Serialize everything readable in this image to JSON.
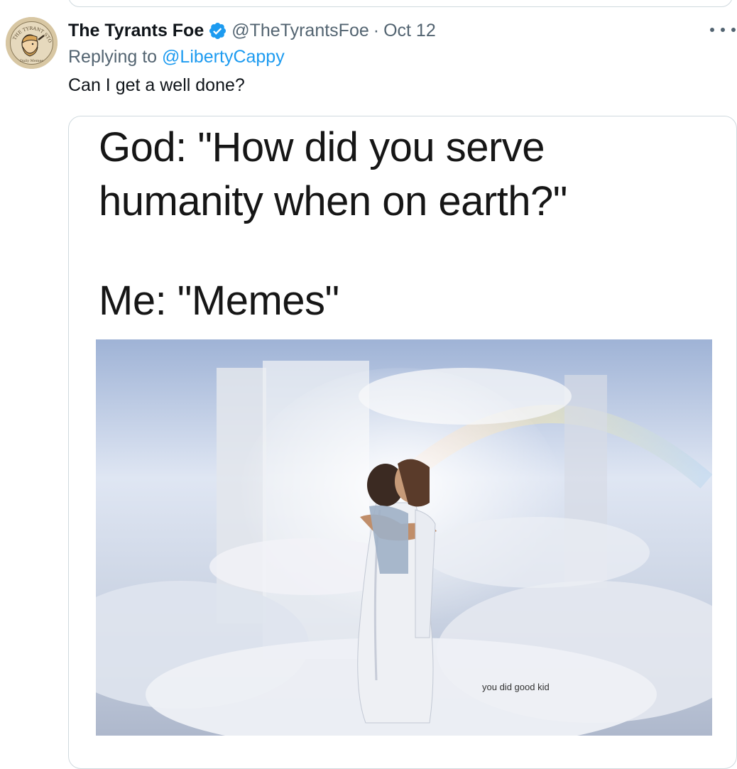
{
  "tweet": {
    "display_name": "The Tyrants Foe",
    "handle": "@TheTyrantsFoe",
    "separator": "·",
    "date": "Oct 12",
    "replying_prefix": "Replying to ",
    "replying_to": "@LibertyCappy",
    "text": "Can I get a well done?",
    "avatar": {
      "ring_text": "THE TYRANT STOP",
      "bottom_text": "Daily Memes"
    }
  },
  "meme": {
    "line1": "God: \"How did you serve",
    "line2": "humanity when on earth?\"",
    "line3": "Me: \"Memes\"",
    "caption": "you did good kid"
  },
  "icons": {
    "verified": "verified-badge-icon",
    "more": "more-options-icon"
  },
  "colors": {
    "link": "#1d9bf0",
    "secondary_text": "#536471",
    "primary_text": "#0f1419",
    "border": "#cfd9de"
  }
}
